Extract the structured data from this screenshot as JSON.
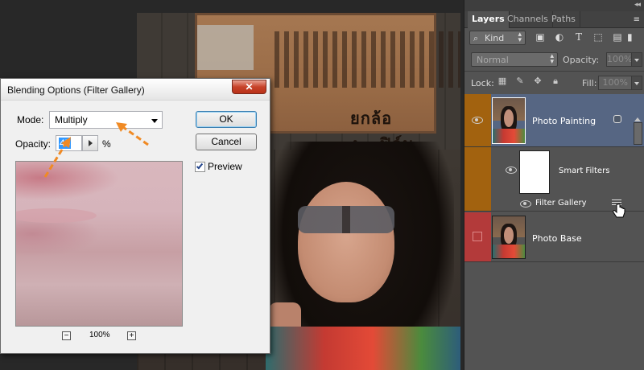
{
  "dialog": {
    "title": "Blending Options (Filter Gallery)",
    "close_glyph": "✕",
    "mode_label": "Mode:",
    "mode_value": "Multiply",
    "opacity_label": "Opacity:",
    "opacity_value": "45",
    "opacity_unit": "%",
    "ok_label": "OK",
    "cancel_label": "Cancel",
    "preview_label": "Preview",
    "preview_checked": true,
    "zoom_out": "−",
    "zoom_in": "+",
    "zoom_level": "100%"
  },
  "photo": {
    "sign_caption": "ยกล้อง...ฟิล์ม"
  },
  "panel": {
    "tabs": [
      "Layers",
      "Channels",
      "Paths"
    ],
    "menu_glyph": "≡",
    "collapse_glyph": "◂◂",
    "kind_filter": "Kind",
    "filter_icons": [
      "image-filter-icon",
      "adjustment-filter-icon",
      "type-filter-icon",
      "shape-filter-icon",
      "smart-object-filter-icon"
    ],
    "blend_mode": "Normal",
    "opacity_label": "Opacity:",
    "opacity_value": "100%",
    "lock_label": "Lock:",
    "fill_label": "Fill:",
    "fill_value": "100%",
    "layers": [
      {
        "name": "Photo Painting",
        "color_tag": "#a2620f",
        "selected": true,
        "visible": true
      },
      {
        "name": "Smart Filters",
        "color_tag": "#a2620f",
        "visible": true
      },
      {
        "name": "Filter Gallery",
        "color_tag": "#a2620f",
        "visible": true
      },
      {
        "name": "Photo Base",
        "color_tag": "#b33a3a",
        "visible": false
      }
    ]
  },
  "colors": {
    "annotation_arrow": "#f08a24",
    "selected_layer": "#566683",
    "orange_tag": "#a2620f",
    "red_tag": "#b33a3a"
  }
}
